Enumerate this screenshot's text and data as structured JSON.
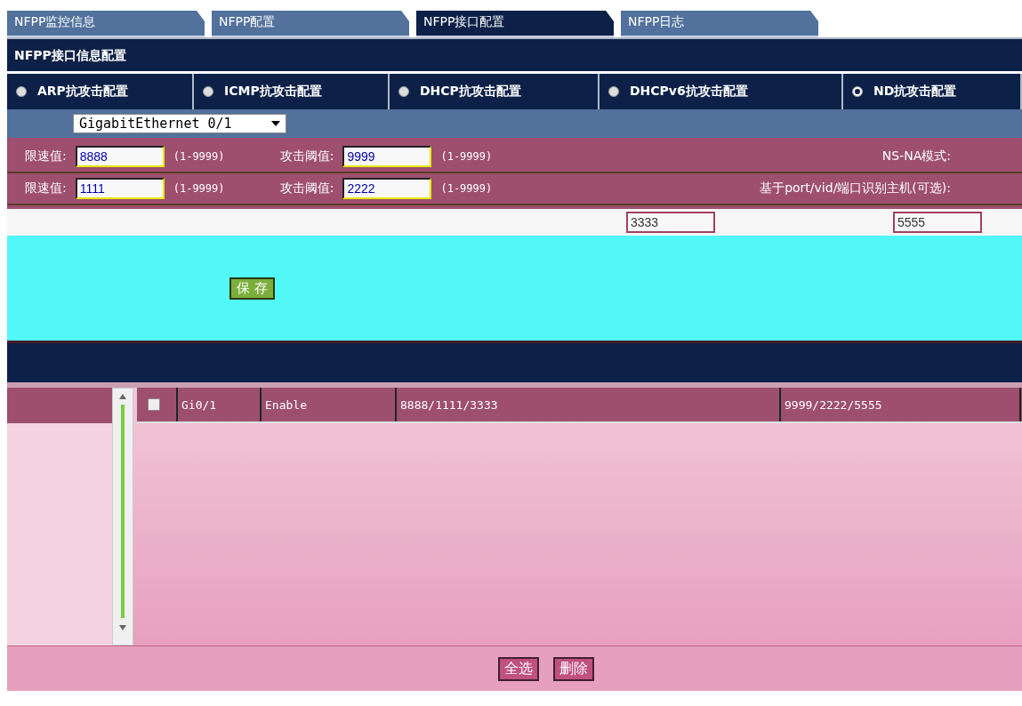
{
  "tabs": [
    {
      "label": "NFPP监控信息",
      "selected": false
    },
    {
      "label": "NFPP配置",
      "selected": false
    },
    {
      "label": "NFPP接口配置",
      "selected": true
    },
    {
      "label": "NFPP日志",
      "selected": false
    }
  ],
  "section_title": "NFPP接口信息配置",
  "attack_types": [
    {
      "label": "ARP抗攻击配置",
      "selected": false
    },
    {
      "label": "ICMP抗攻击配置",
      "selected": false
    },
    {
      "label": "DHCP抗攻击配置",
      "selected": false
    },
    {
      "label": "DHCPv6抗攻击配置",
      "selected": false
    },
    {
      "label": "ND抗攻击配置",
      "selected": true
    }
  ],
  "interface": {
    "value": "GigabitEthernet 0/1"
  },
  "form_rows": [
    {
      "rate_label": "限速值:",
      "rate_value": "8888",
      "rate_range": "(1-9999)",
      "threshold_label": "攻击阈值:",
      "threshold_value": "9999",
      "threshold_range": "(1-9999)",
      "extra_label": "NS-NA模式:"
    },
    {
      "rate_label": "限速值:",
      "rate_value": "1111",
      "rate_range": "(1-9999)",
      "threshold_label": "攻击阈值:",
      "threshold_value": "2222",
      "threshold_range": "(1-9999)",
      "extra_label": "基于port/vid/端口识别主机(可选):"
    }
  ],
  "extra_values": [
    "3333",
    "5555"
  ],
  "save_button": "保 存",
  "table": {
    "rows": [
      {
        "checked": false,
        "cells": [
          "Gi0/1",
          "Enable",
          "8888/1111/3333",
          "9999/2222/5555"
        ]
      }
    ]
  },
  "buttons": [
    "全选",
    "删除"
  ]
}
